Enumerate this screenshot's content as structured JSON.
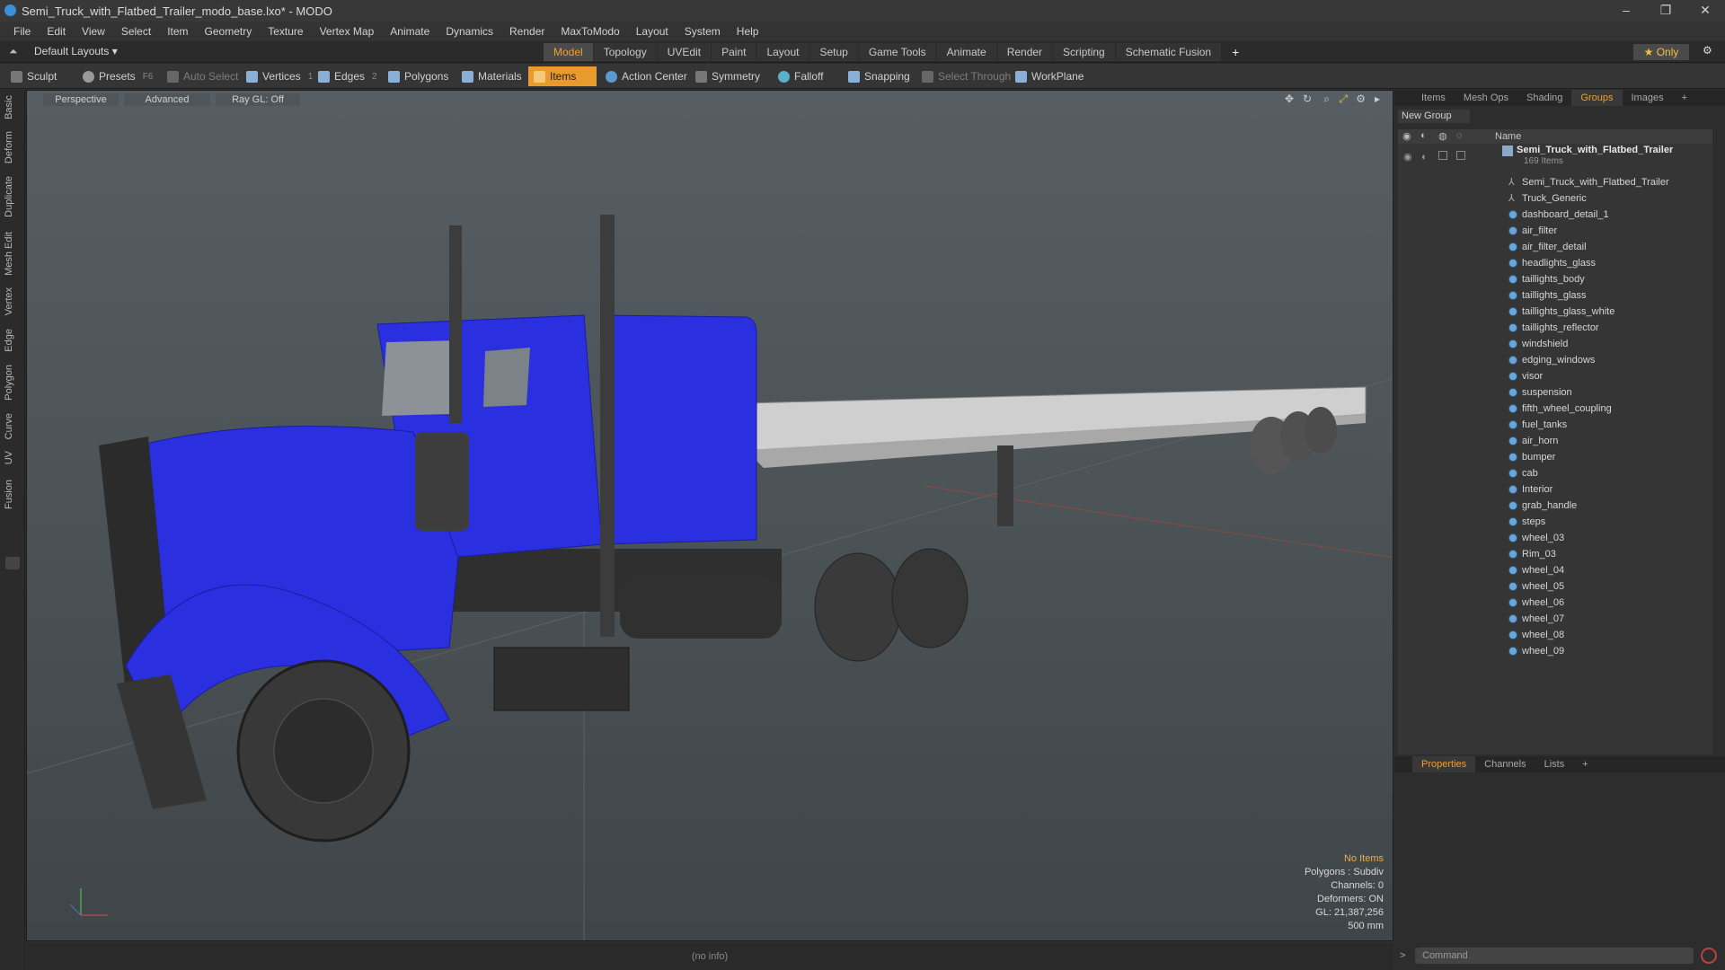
{
  "window": {
    "title": "Semi_Truck_with_Flatbed_Trailer_modo_base.lxo* - MODO"
  },
  "menu": [
    "File",
    "Edit",
    "View",
    "Select",
    "Item",
    "Geometry",
    "Texture",
    "Vertex Map",
    "Animate",
    "Dynamics",
    "Render",
    "MaxToModo",
    "Layout",
    "System",
    "Help"
  ],
  "layout": {
    "label": "Default Layouts ▾"
  },
  "tabs": [
    "Model",
    "Topology",
    "UVEdit",
    "Paint",
    "Layout",
    "Setup",
    "Game Tools",
    "Animate",
    "Render",
    "Scripting",
    "Schematic Fusion",
    "+"
  ],
  "only_label": "★  Only",
  "toolbar": {
    "sculpt": "Sculpt",
    "presets": "Presets",
    "presets_key": "F6",
    "auto_select": "Auto Select",
    "vertices": "Vertices",
    "vertices_key": "1",
    "edges": "Edges",
    "edges_key": "2",
    "polygons": "Polygons",
    "materials": "Materials",
    "items": "Items",
    "action_center": "Action Center",
    "symmetry": "Symmetry",
    "falloff": "Falloff",
    "snapping": "Snapping",
    "select_through": "Select Through",
    "workplane": "WorkPlane"
  },
  "left_tabs": [
    "Basic",
    "Deform",
    "Duplicate",
    "Mesh Edit",
    "Vertex",
    "Edge",
    "Polygon",
    "Curve",
    "UV",
    "Fusion"
  ],
  "viewport": {
    "perspective": "Perspective",
    "advanced": "Advanced",
    "raygl": "Ray GL: Off",
    "info": {
      "no_items": "No Items",
      "polygons": "Polygons : Subdiv",
      "channels": "Channels: 0",
      "deformers": "Deformers: ON",
      "gl": "GL: 21,387,256",
      "scale": "500 mm"
    }
  },
  "status": "(no info)",
  "panel": {
    "tabs": [
      "Items",
      "Mesh Ops",
      "Shading",
      "Groups",
      "Images",
      "+"
    ],
    "new_group": "New Group",
    "name_header": "Name",
    "root": "Semi_Truck_with_Flatbed_Trailer",
    "root_count": "169 Items",
    "items": [
      "Semi_Truck_with_Flatbed_Trailer",
      "Truck_Generic",
      "dashboard_detail_1",
      "air_filter",
      "air_filter_detail",
      "headlights_glass",
      "taillights_body",
      "taillights_glass",
      "taillights_glass_white",
      "taillights_reflector",
      "windshield",
      "edging_windows",
      "visor",
      "suspension",
      "fifth_wheel_coupling",
      "fuel_tanks",
      "air_horn",
      "bumper",
      "cab",
      "Interior",
      "grab_handle",
      "steps",
      "wheel_03",
      "Rim_03",
      "wheel_04",
      "wheel_05",
      "wheel_06",
      "wheel_07",
      "wheel_08",
      "wheel_09"
    ],
    "bottom_tabs": [
      "Properties",
      "Channels",
      "Lists",
      "+"
    ],
    "command_placeholder": "Command"
  },
  "colors": {
    "accent": "#e89a2c",
    "truck": "#2a2fe0"
  }
}
